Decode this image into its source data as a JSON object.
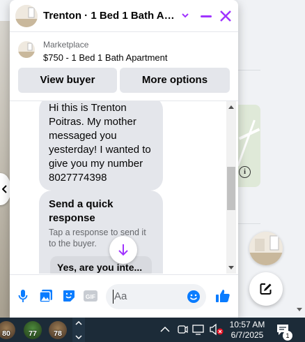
{
  "chat": {
    "title": "Trenton · 1 Bed 1 Bath Apa...",
    "marketplace_label": "Marketplace",
    "listing": "$750 - 1 Bed 1 Bath Apartment",
    "buttons": {
      "view_buyer": "View buyer",
      "more_options": "More options"
    },
    "message_lines": [
      "Hi this is Trenton",
      "Poitras. My mother",
      "messaged you",
      "yesterday! I wanted to",
      "give you my number",
      "8027774398"
    ],
    "quick_response": {
      "title_lines": [
        "Send a quick",
        "response"
      ],
      "subtitle_lines": [
        "Tap a response to send it",
        "to the buyer."
      ],
      "option": "Yes, are you inte..."
    },
    "composer_placeholder": "Aa"
  },
  "colors": {
    "accent": "#a033ff",
    "messenger_blue": "#0a7cff"
  },
  "taskbar": {
    "temps": [
      "80",
      "77",
      "78"
    ],
    "time": "10:57 AM",
    "date": "6/7/2025",
    "notification_count": "1"
  }
}
